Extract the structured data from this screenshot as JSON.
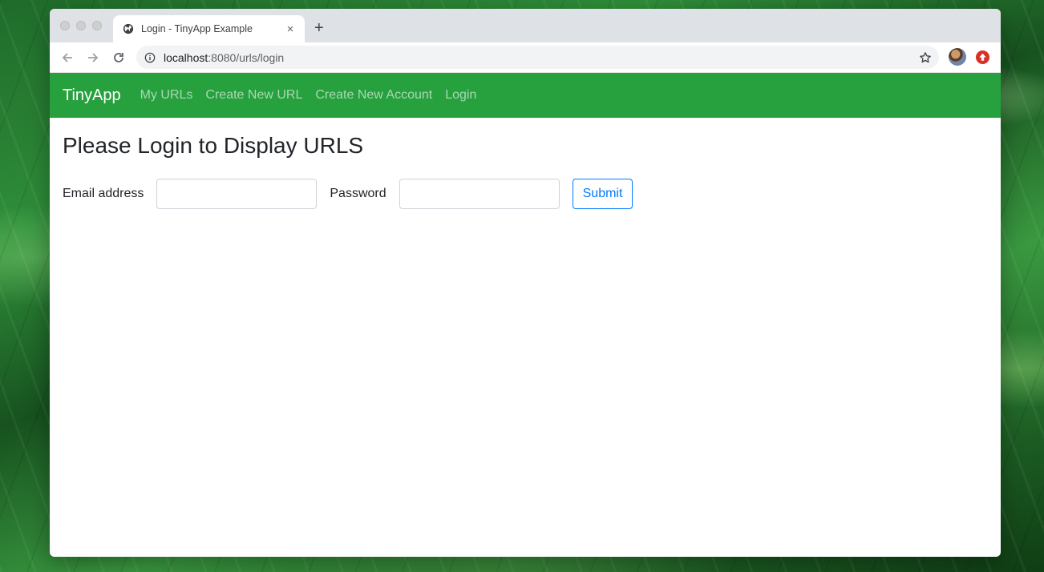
{
  "browser": {
    "tab": {
      "title": "Login - TinyApp Example",
      "close_label": "×"
    },
    "new_tab_label": "+",
    "address": {
      "host": "localhost",
      "path": ":8080/urls/login"
    }
  },
  "navbar": {
    "brand": "TinyApp",
    "links": [
      {
        "label": "My URLs"
      },
      {
        "label": "Create New URL"
      },
      {
        "label": "Create New Account"
      },
      {
        "label": "Login"
      }
    ],
    "colors": {
      "background": "#27a03e"
    }
  },
  "main": {
    "title": "Please Login to Display URLS",
    "form": {
      "email_label": "Email address",
      "email_value": "",
      "password_label": "Password",
      "password_value": "",
      "submit_label": "Submit"
    }
  },
  "icons": {
    "tab_favicon": "globe-icon",
    "back": "arrow-left-icon",
    "forward": "arrow-right-icon",
    "reload": "reload-icon",
    "site_info": "info-icon",
    "bookmark": "star-icon",
    "profile": "avatar",
    "extension": "extension-icon"
  }
}
